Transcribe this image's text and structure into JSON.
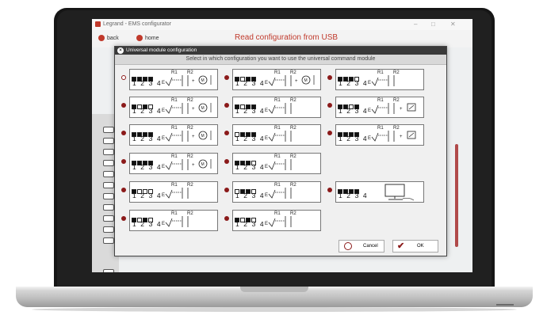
{
  "window": {
    "title": "Legrand - EMS configurator",
    "minimize": "–",
    "maximize": "□",
    "close": "✕"
  },
  "nav": {
    "back_label": "back",
    "home_label": "home",
    "page_title": "Read configuration from USB"
  },
  "dialog": {
    "title": "Universal module configuration",
    "instruction": "Select in which configuration you want to use the universal command module",
    "cancel_label": "Cancel",
    "ok_label": "OK"
  },
  "options": [
    {
      "id": "o1",
      "switches": [
        1,
        1,
        1,
        1
      ],
      "labels": [
        "R1",
        "R2"
      ],
      "load": "motor",
      "selected": true
    },
    {
      "id": "o2",
      "switches": [
        1,
        0,
        1,
        1
      ],
      "labels": [
        "R1",
        "R2"
      ],
      "load": "motor",
      "selected": false
    },
    {
      "id": "o3",
      "switches": [
        1,
        1,
        1,
        0
      ],
      "labels": [
        "R1",
        "R2"
      ],
      "load": "none",
      "selected": false
    },
    {
      "id": "o4",
      "switches": [
        1,
        0,
        1,
        0
      ],
      "labels": [
        "R1",
        "R2"
      ],
      "load": "motor",
      "selected": false
    },
    {
      "id": "o5",
      "switches": [
        1,
        0,
        1,
        1
      ],
      "labels": [
        "R1",
        "R2"
      ],
      "load": "none",
      "selected": false
    },
    {
      "id": "o6",
      "switches": [
        1,
        1,
        0,
        1
      ],
      "labels": [
        "R1",
        "R2"
      ],
      "load": "relay",
      "selected": false
    },
    {
      "id": "o7",
      "switches": [
        1,
        1,
        1,
        1
      ],
      "labels": [
        "R1",
        "R2"
      ],
      "load": "motor",
      "selected": false
    },
    {
      "id": "o8",
      "switches": [
        0,
        1,
        1,
        1
      ],
      "labels": [
        "R1",
        "R2"
      ],
      "load": "none",
      "selected": false
    },
    {
      "id": "o9",
      "switches": [
        1,
        1,
        1,
        1
      ],
      "labels": [
        "R1",
        "R2"
      ],
      "load": "relay",
      "selected": false
    },
    {
      "id": "o10",
      "switches": [
        1,
        1,
        1,
        1
      ],
      "labels": [
        "R1",
        "R2"
      ],
      "load": "motor",
      "selected": false
    },
    {
      "id": "o11",
      "switches": [
        1,
        1,
        1,
        0
      ],
      "labels": [
        "R1",
        "R2"
      ],
      "load": "none",
      "selected": false
    },
    {
      "id": "o12",
      "switches": [
        1,
        0,
        0,
        0
      ],
      "labels": [
        "R1",
        "R2"
      ],
      "load": "none",
      "selected": false
    },
    {
      "id": "o13",
      "switches": [
        0,
        1,
        1,
        0
      ],
      "labels": [
        "R1",
        "R2"
      ],
      "load": "none",
      "selected": false
    },
    {
      "id": "o14",
      "switches": [
        1,
        1,
        1,
        1
      ],
      "labels": [],
      "load": "computer",
      "selected": false
    },
    {
      "id": "o15",
      "switches": [
        1,
        0,
        1,
        0
      ],
      "labels": [
        "R1",
        "R2"
      ],
      "load": "none",
      "selected": false
    },
    {
      "id": "o16",
      "switches": [
        1,
        0,
        1,
        0
      ],
      "labels": [
        "R1",
        "R2"
      ],
      "load": "none",
      "selected": false
    }
  ],
  "digits": "1 2 3 4",
  "colors": {
    "accent": "#8b1a1a",
    "title_red": "#c0392b",
    "dialog_bar": "#3a3a3a"
  }
}
